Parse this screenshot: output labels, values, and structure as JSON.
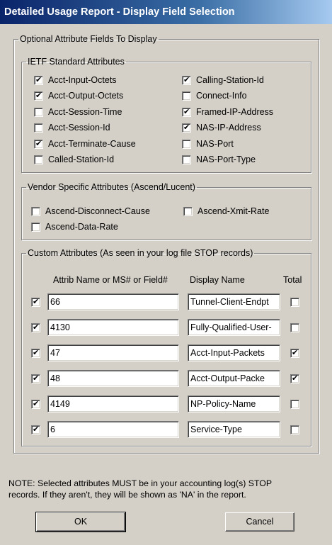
{
  "window": {
    "title": "Detailed Usage Report - Display Field Selection"
  },
  "optional_group": {
    "legend": "Optional Attribute Fields To Display"
  },
  "ietf": {
    "legend": "IETF Standard Attributes",
    "left": [
      {
        "label": "Acct-Input-Octets",
        "checked": true
      },
      {
        "label": "Acct-Output-Octets",
        "checked": true
      },
      {
        "label": "Acct-Session-Time",
        "checked": false
      },
      {
        "label": "Acct-Session-Id",
        "checked": false
      },
      {
        "label": "Acct-Terminate-Cause",
        "checked": true
      },
      {
        "label": "Called-Station-Id",
        "checked": false
      }
    ],
    "right": [
      {
        "label": "Calling-Station-Id",
        "checked": true
      },
      {
        "label": "Connect-Info",
        "checked": false
      },
      {
        "label": "Framed-IP-Address",
        "checked": true
      },
      {
        "label": "NAS-IP-Address",
        "checked": true
      },
      {
        "label": "NAS-Port",
        "checked": false
      },
      {
        "label": "NAS-Port-Type",
        "checked": false
      }
    ]
  },
  "vendor": {
    "legend": "Vendor Specific Attributes (Ascend/Lucent)",
    "items": [
      {
        "label": "Ascend-Disconnect-Cause",
        "checked": false
      },
      {
        "label": "Ascend-Xmit-Rate",
        "checked": false
      },
      {
        "label": "Ascend-Data-Rate",
        "checked": false
      }
    ]
  },
  "custom": {
    "legend": "Custom Attributes (As seen in your log file STOP records)",
    "headers": {
      "attrib": "Attrib Name or MS# or Field#",
      "display": "Display Name",
      "total": "Total"
    },
    "rows": [
      {
        "enabled": true,
        "attrib": "66",
        "display": "Tunnel-Client-Endpt",
        "total": false
      },
      {
        "enabled": true,
        "attrib": "4130",
        "display": "Fully-Qualified-User-",
        "total": false
      },
      {
        "enabled": true,
        "attrib": "47",
        "display": "Acct-Input-Packets",
        "total": true
      },
      {
        "enabled": true,
        "attrib": "48",
        "display": "Acct-Output-Packe",
        "total": true
      },
      {
        "enabled": true,
        "attrib": "4149",
        "display": "NP-Policy-Name",
        "total": false
      },
      {
        "enabled": true,
        "attrib": "6",
        "display": "Service-Type",
        "total": false
      }
    ]
  },
  "note": {
    "line1": "NOTE: Selected attributes MUST be in your accounting log(s) STOP",
    "line2": "records.  If they aren't, they will be shown as 'NA' in the report."
  },
  "buttons": {
    "ok": "OK",
    "cancel": "Cancel"
  }
}
